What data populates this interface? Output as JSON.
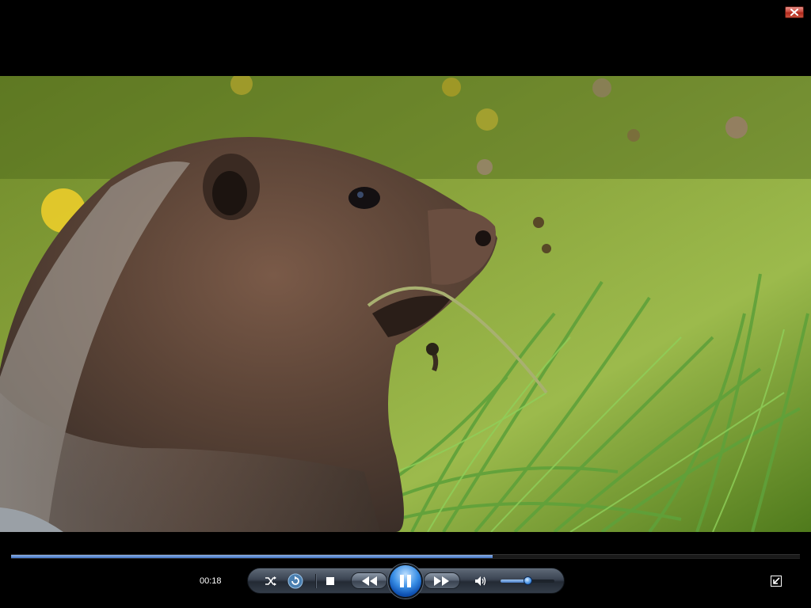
{
  "window": {
    "close_icon": "close-icon",
    "close_color": "#c9493c"
  },
  "video": {
    "description_icon": "video-frame"
  },
  "playback": {
    "elapsed_time": "00:18",
    "progress": 0.61,
    "volume": 0.5,
    "state": "playing"
  },
  "controls": {
    "shuffle_icon": "shuffle-icon",
    "repeat_icon": "repeat-icon",
    "stop_icon": "stop-icon",
    "previous_icon": "rewind-icon",
    "play_pause_icon": "pause-icon",
    "next_icon": "fast-forward-icon",
    "mute_icon": "speaker-icon",
    "switch_view_icon": "switch-to-library-icon"
  },
  "colors": {
    "accent": "#3a8fe6",
    "seek_fill": "#5f8fd8",
    "background": "#000000"
  }
}
